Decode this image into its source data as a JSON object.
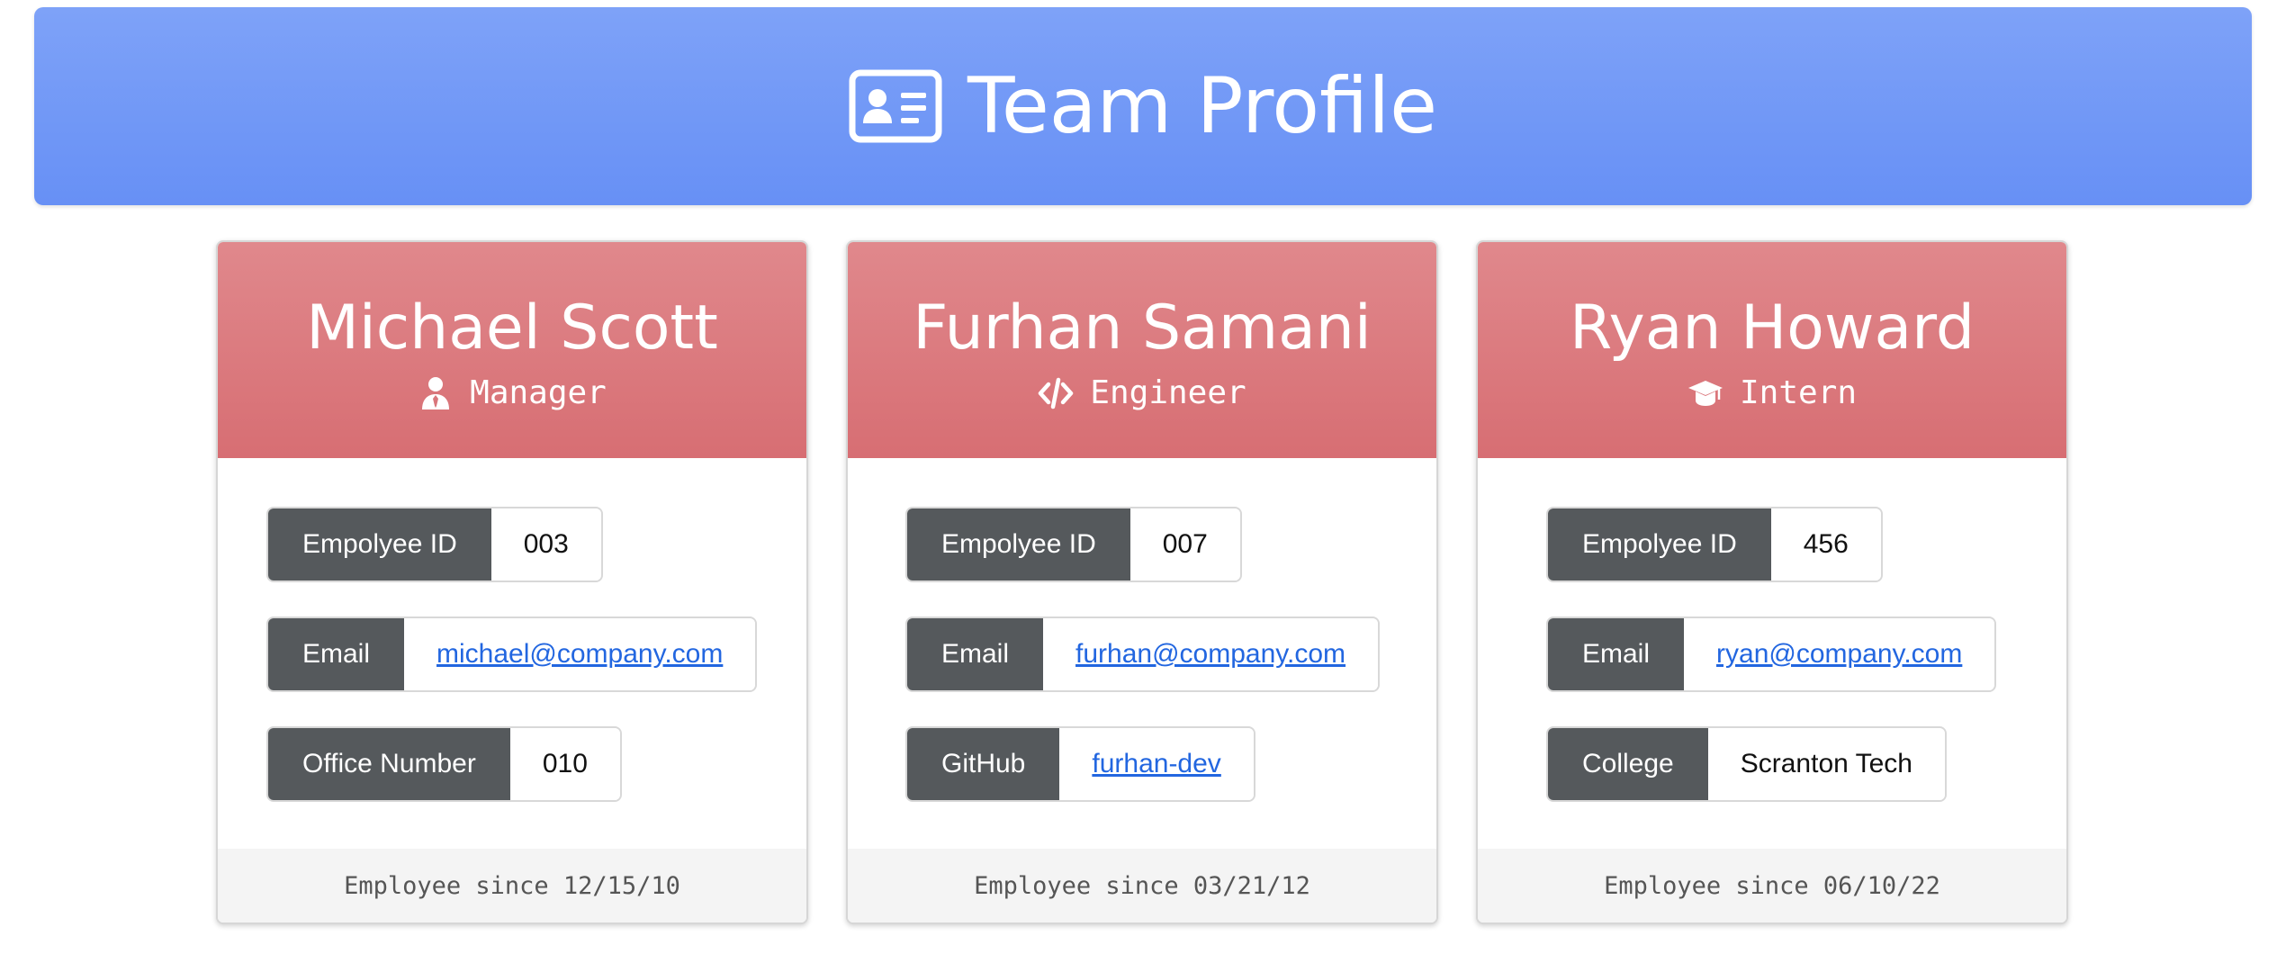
{
  "header": {
    "title": "Team Profile",
    "icon": "id-card-icon",
    "gradient": [
      "#7ea2f8",
      "#6790f5"
    ]
  },
  "colors": {
    "card_header": "#d9767b",
    "label_bg": "#55595c",
    "link": "#2266e0"
  },
  "cards": [
    {
      "name": "Michael Scott",
      "role": "Manager",
      "role_icon": "person-tie-icon",
      "fields": [
        {
          "label": "Empolyee ID",
          "value": "003"
        },
        {
          "label": "Email",
          "value": "michael@company.com"
        },
        {
          "label": "Office Number",
          "value": "010"
        }
      ],
      "footer": "Employee since 12/15/10"
    },
    {
      "name": "Furhan Samani",
      "role": "Engineer",
      "role_icon": "code-icon",
      "fields": [
        {
          "label": "Empolyee ID",
          "value": "007"
        },
        {
          "label": "Email",
          "value": "furhan@company.com"
        },
        {
          "label": "GitHub",
          "value": "furhan-dev"
        }
      ],
      "footer": "Employee since 03/21/12"
    },
    {
      "name": "Ryan Howard",
      "role": "Intern",
      "role_icon": "graduation-cap-icon",
      "fields": [
        {
          "label": "Empolyee ID",
          "value": "456"
        },
        {
          "label": "Email",
          "value": "ryan@company.com"
        },
        {
          "label": "College",
          "value": "Scranton Tech"
        }
      ],
      "footer": "Employee since 06/10/22"
    }
  ]
}
